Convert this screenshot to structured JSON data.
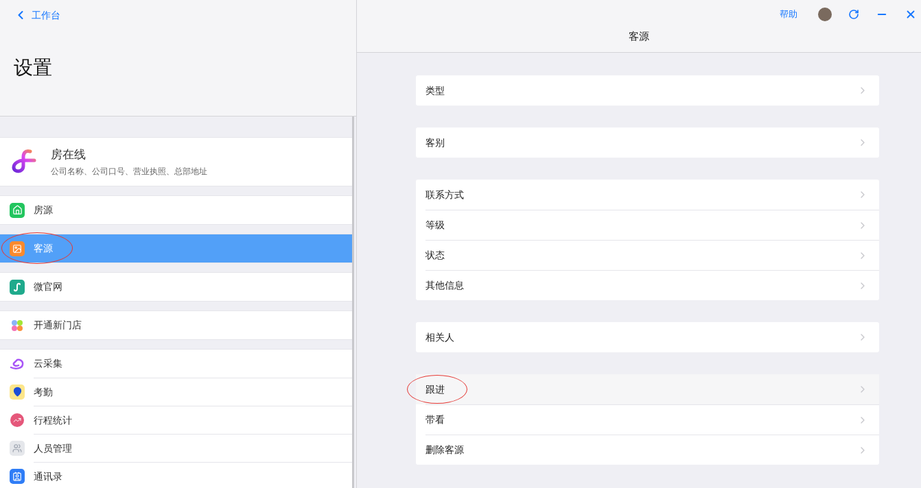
{
  "sidebar": {
    "back_link": "工作台",
    "title": "设置",
    "company": {
      "name": "房在线",
      "subtitle": "公司名称、公司口号、营业执照、总部地址"
    },
    "groups": [
      [
        {
          "label": "房源",
          "kind": "house",
          "selected": false,
          "circled": false
        }
      ],
      [
        {
          "label": "客源",
          "kind": "customer",
          "selected": true,
          "circled": true
        }
      ],
      [
        {
          "label": "微官网",
          "kind": "miniapp",
          "selected": false,
          "circled": false
        }
      ],
      [
        {
          "label": "开通新门店",
          "kind": "store",
          "selected": false,
          "circled": false
        }
      ],
      [
        {
          "label": "云采集",
          "kind": "cloud",
          "selected": false,
          "circled": false
        },
        {
          "label": "考勤",
          "kind": "attendance",
          "selected": false,
          "circled": false
        },
        {
          "label": "行程统计",
          "kind": "trip",
          "selected": false,
          "circled": false
        },
        {
          "label": "人员管理",
          "kind": "staff",
          "selected": false,
          "circled": false
        },
        {
          "label": "通讯录",
          "kind": "contacts",
          "selected": false,
          "circled": false
        }
      ]
    ]
  },
  "topbar": {
    "help": "帮助"
  },
  "main": {
    "title": "客源",
    "groups": [
      [
        {
          "label": "类型",
          "hovered": false,
          "circled": false
        }
      ],
      [
        {
          "label": "客别",
          "hovered": false,
          "circled": false
        }
      ],
      [
        {
          "label": "联系方式",
          "hovered": false,
          "circled": false
        },
        {
          "label": "等级",
          "hovered": false,
          "circled": false
        },
        {
          "label": "状态",
          "hovered": false,
          "circled": false
        },
        {
          "label": "其他信息",
          "hovered": false,
          "circled": false
        }
      ],
      [
        {
          "label": "相关人",
          "hovered": false,
          "circled": false
        }
      ],
      [
        {
          "label": "跟进",
          "hovered": true,
          "circled": true
        },
        {
          "label": "带看",
          "hovered": false,
          "circled": false
        },
        {
          "label": "删除客源",
          "hovered": false,
          "circled": false
        }
      ]
    ]
  }
}
